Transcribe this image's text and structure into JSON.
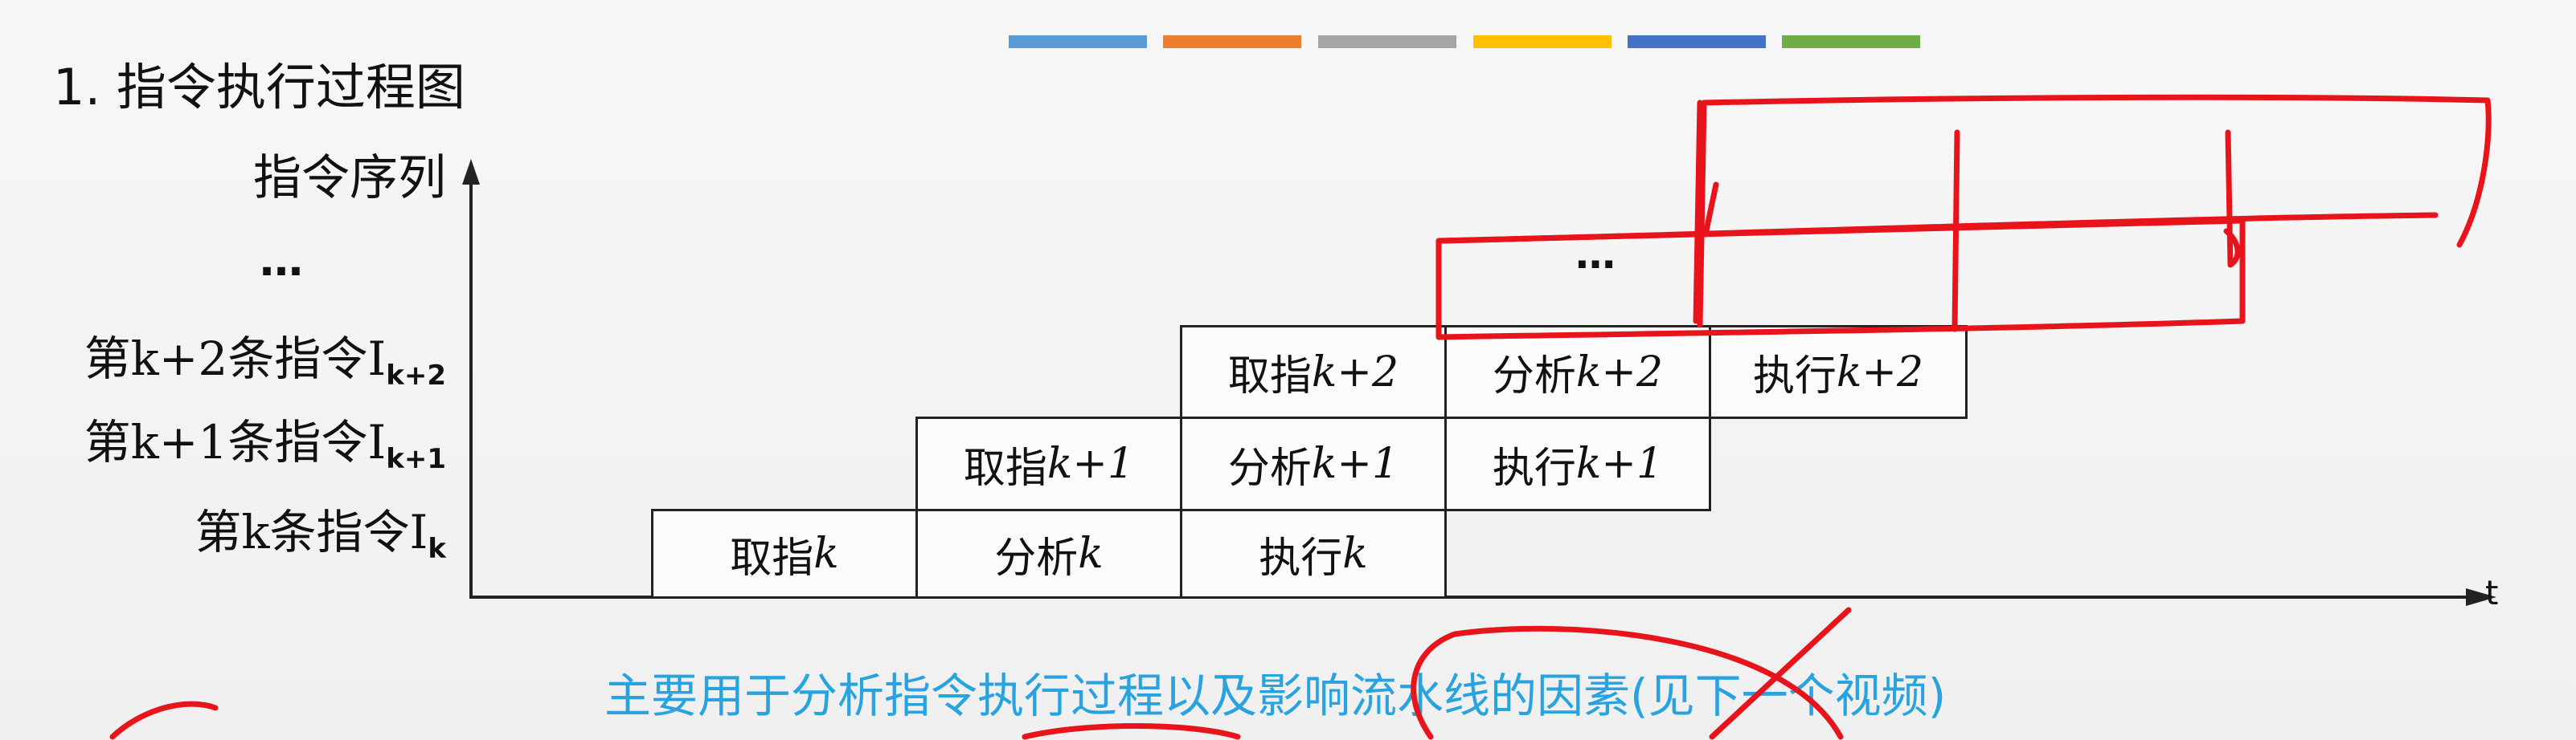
{
  "title": "1. 指令执行过程图",
  "y_axis_label": "指令序列",
  "top_ellipsis": "…",
  "rows": [
    {
      "main": "第k+2条指令I",
      "sub": "k+2"
    },
    {
      "main": "第k+1条指令I",
      "sub": "k+1"
    },
    {
      "main": "第k条指令I",
      "sub": "k"
    }
  ],
  "cells": {
    "fetch_k": {
      "prefix": "取指",
      "k": "k"
    },
    "analyze_k": {
      "prefix": "分析",
      "k": "k"
    },
    "exec_k": {
      "prefix": "执行",
      "k": "k"
    },
    "fetch_k1": {
      "prefix": "取指",
      "k": "k+1"
    },
    "analyze_k1": {
      "prefix": "分析",
      "k": "k+1"
    },
    "exec_k1": {
      "prefix": "执行",
      "k": "k+1"
    },
    "fetch_k2": {
      "prefix": "取指",
      "k": "k+2"
    },
    "analyze_k2": {
      "prefix": "分析",
      "k": "k+2"
    },
    "exec_k2": {
      "prefix": "执行",
      "k": "k+2"
    }
  },
  "mid_ellipsis": "…",
  "x_axis_label": "t",
  "note": "主要用于分析指令执行过程以及影响流水线的因素(见下一个视频)",
  "colors": {
    "bars": [
      "#5b9bd5",
      "#ed7d31",
      "#a5a5a5",
      "#ffc000",
      "#4472c4",
      "#70ad47"
    ],
    "note": "#29a3e0",
    "ink": "#e8141b"
  }
}
